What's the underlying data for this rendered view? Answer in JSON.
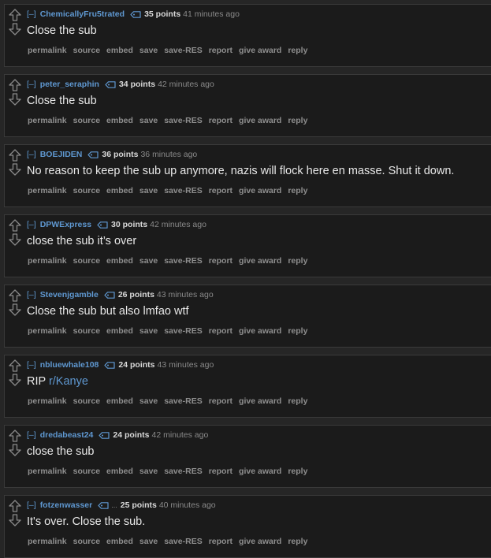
{
  "ui": {
    "expand_label": "[–]",
    "points_suffix": "points",
    "buttons": [
      "permalink",
      "source",
      "embed",
      "save",
      "save-RES",
      "report",
      "give award",
      "reply"
    ],
    "link_color": "#5f98d1",
    "icons": {
      "upvote": "up-arrow-icon",
      "downvote": "down-arrow-icon",
      "flair": "tag-icon"
    }
  },
  "comments": [
    {
      "author": "ChemicallyFru5trated",
      "score": "35",
      "time": "41 minutes ago",
      "text": "Close the sub"
    },
    {
      "author": "peter_seraphin",
      "score": "34",
      "time": "42 minutes ago",
      "text": "Close the sub"
    },
    {
      "author": "BOEJIDEN",
      "score": "36",
      "time": "36 minutes ago",
      "text": "No reason to keep the sub up anymore, nazis will flock here en masse. Shut it down."
    },
    {
      "author": "DPWExpress",
      "score": "30",
      "time": "42 minutes ago",
      "text": "close the sub it’s over"
    },
    {
      "author": "Stevenjgamble",
      "score": "26",
      "time": "43 minutes ago",
      "text": "Close the sub but also lmfao wtf"
    },
    {
      "author": "nbluewhale108",
      "score": "24",
      "time": "43 minutes ago",
      "text": "RIP ",
      "link": "r/Kanye"
    },
    {
      "author": "dredabeast24",
      "score": "24",
      "time": "42 minutes ago",
      "text": "close the sub"
    },
    {
      "author": "fotzenwasser",
      "score": "25",
      "time": "40 minutes ago",
      "text": "It's over. Close the sub.",
      "flair_text": "..."
    }
  ]
}
